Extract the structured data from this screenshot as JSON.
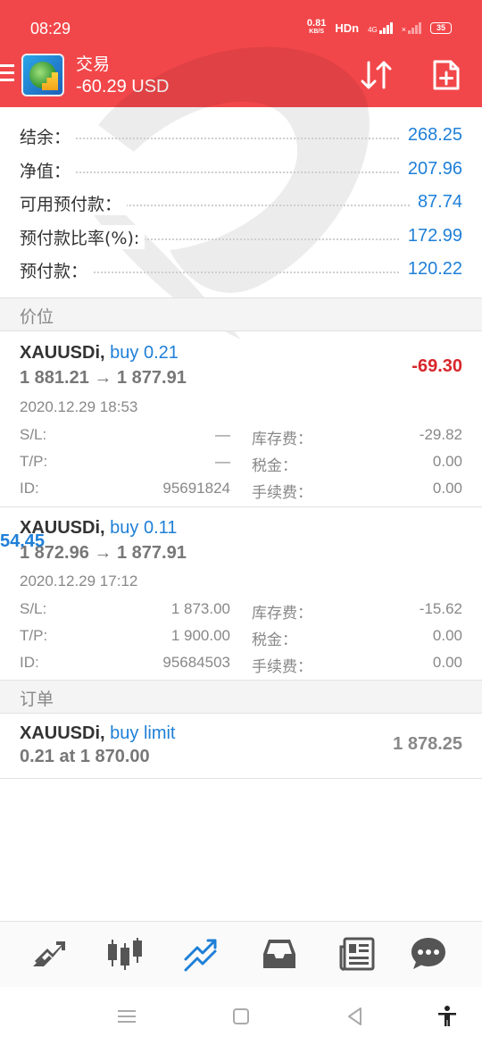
{
  "status_bar": {
    "time": "08:29",
    "net_speed": "0.81",
    "net_speed_unit": "KB/S",
    "hd": "HDn",
    "net_type": "4G",
    "battery": "35"
  },
  "header": {
    "title": "交易",
    "balance": "-60.29 USD",
    "icons": [
      "menu-icon",
      "app-logo",
      "sort-arrows-icon",
      "new-order-icon"
    ],
    "bg_color": "#f2474a"
  },
  "summary": [
    {
      "label": "结余：",
      "value": "268.25"
    },
    {
      "label": "净值：",
      "value": "207.96"
    },
    {
      "label": "可用预付款：",
      "value": "87.74"
    },
    {
      "label": "预付款比率(%):",
      "value": "172.99"
    },
    {
      "label": "预付款：",
      "value": "120.22"
    }
  ],
  "sections": {
    "positions": "价位",
    "orders": "订单"
  },
  "positions": [
    {
      "symbol": "XAUUSDi,",
      "trade": "buy 0.21",
      "prices": "1 881.21 → 1 877.91",
      "profit": "-69.30",
      "time": "2020.12.29 18:53",
      "sl_label": "S/L:",
      "sl": "—",
      "tp_label": "T/P:",
      "tp": "—",
      "id_label": "ID:",
      "id": "95691824",
      "swap_label": "库存费：",
      "swap": "-29.82",
      "tax_label": "税金：",
      "tax": "0.00",
      "fee_label": "手续费：",
      "fee": "0.00"
    },
    {
      "symbol": "XAUUSDi,",
      "trade": "buy 0.11",
      "prices": "1 872.96 → 1 877.91",
      "profit": "54.45",
      "time": "2020.12.29 17:12",
      "sl_label": "S/L:",
      "sl": "1 873.00",
      "tp_label": "T/P:",
      "tp": "1 900.00",
      "id_label": "ID:",
      "id": "95684503",
      "swap_label": "库存费：",
      "swap": "-15.62",
      "tax_label": "税金：",
      "tax": "0.00",
      "fee_label": "手续费：",
      "fee": "0.00"
    }
  ],
  "orders": [
    {
      "symbol": "XAUUSDi,",
      "trade": "buy limit",
      "detail": "0.21 at 1 870.00",
      "price": "1 878.25"
    }
  ],
  "bottom_nav": [
    "quotes-icon",
    "chart-icon",
    "trade-icon",
    "history-icon",
    "news-icon",
    "chat-icon"
  ],
  "system_nav": [
    "recent-apps-icon",
    "home-icon",
    "back-icon",
    "accessibility-icon"
  ],
  "colors": {
    "accent_blue": "#1e7fd8",
    "loss_red": "#d7262b",
    "header_red": "#f2474a"
  }
}
